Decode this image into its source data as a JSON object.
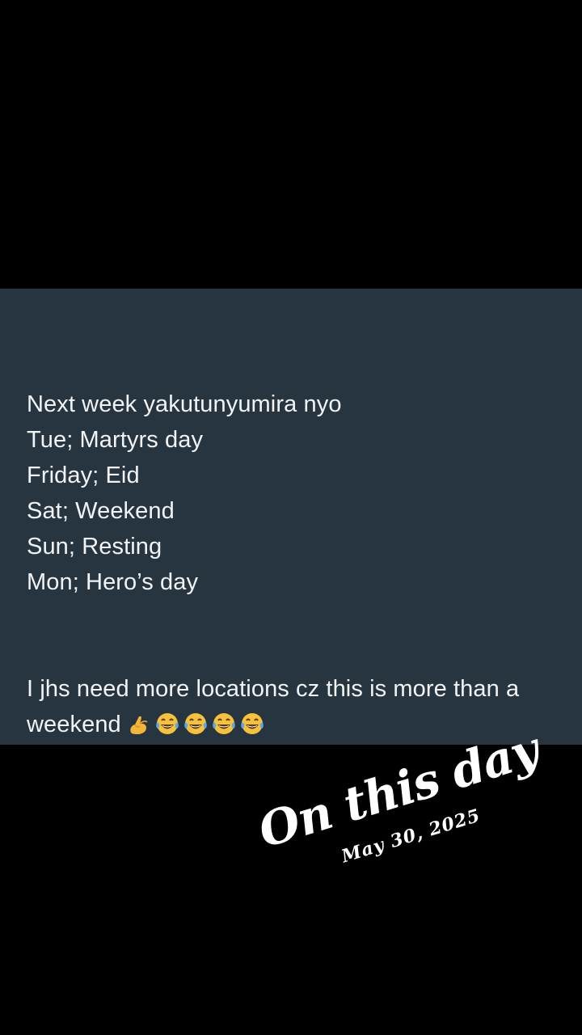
{
  "note": {
    "lines": [
      "Next week yakutunyumira nyo",
      "Tue; Martyrs day",
      "Friday; Eid",
      "Sat; Weekend",
      "Sun; Resting",
      "Mon; Hero’s day"
    ],
    "closing_text": "I jhs need more locations cz this is more than a weekend",
    "emojis": [
      "pinching-hand-icon",
      "tears-of-joy-icon",
      "tears-of-joy-icon",
      "tears-of-joy-icon",
      "tears-of-joy-icon"
    ]
  },
  "memory_stamp": {
    "title": "On this day",
    "date": "May 30, 2025"
  },
  "colors": {
    "panel_background": "#26353f",
    "text": "#f1f3f4",
    "page_background": "#000000"
  }
}
